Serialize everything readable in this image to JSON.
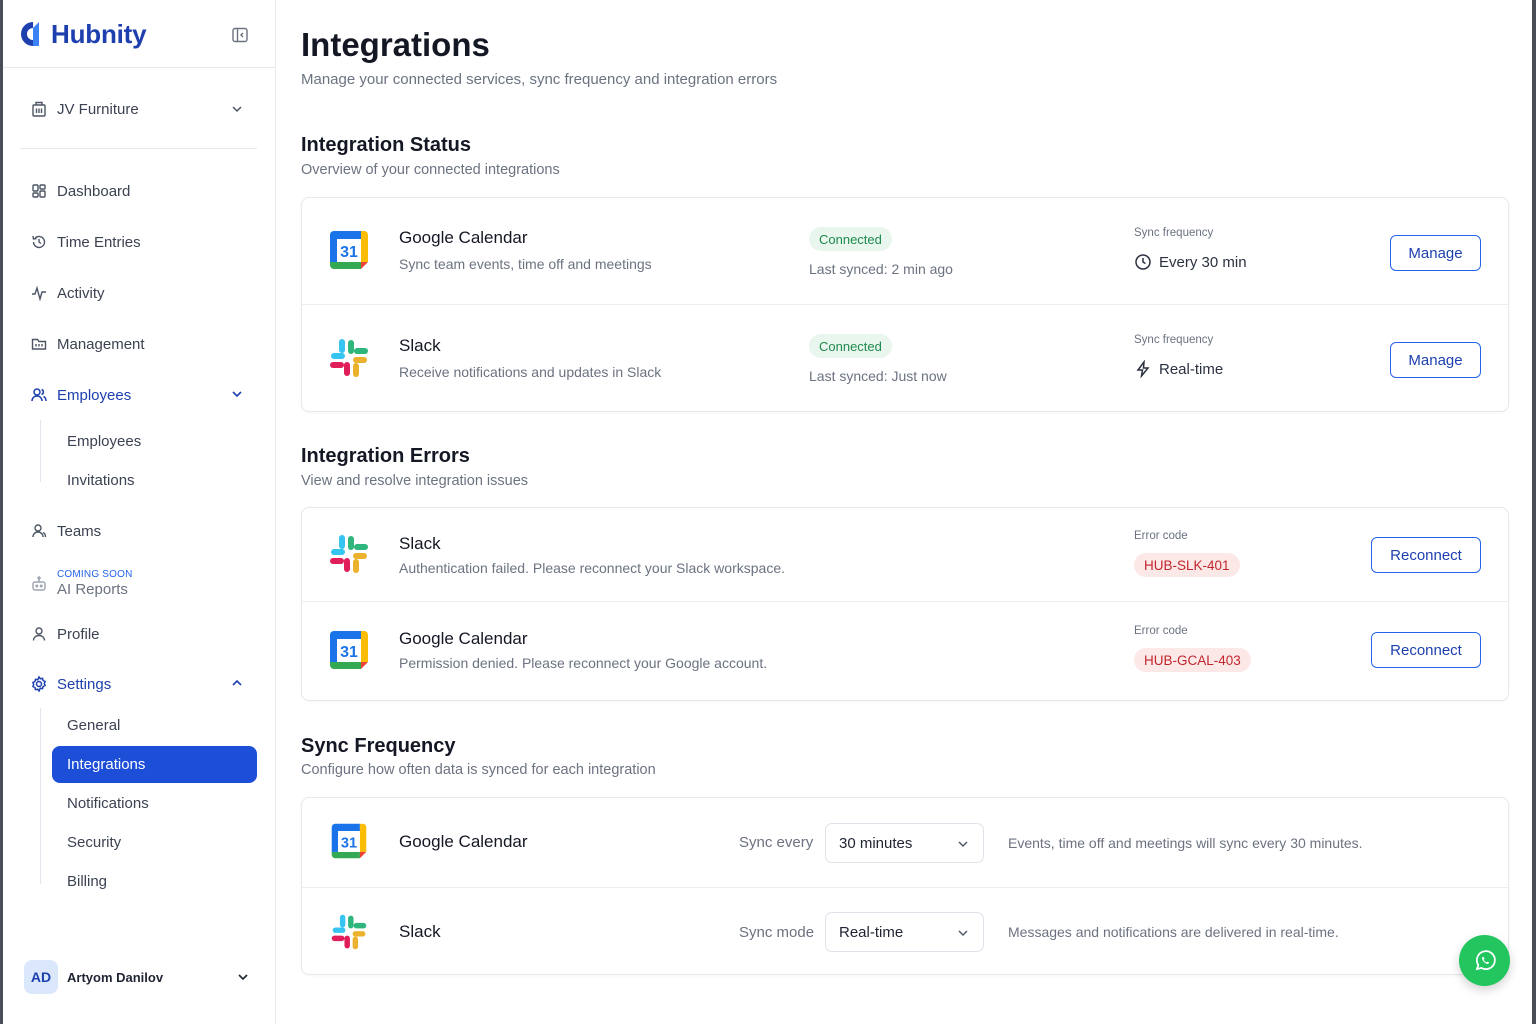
{
  "app": {
    "name": "Hubnity"
  },
  "sidebar": {
    "org": "JV Furniture",
    "items": [
      {
        "label": "Dashboard",
        "icon": "dashboard-icon"
      },
      {
        "label": "Time Entries",
        "icon": "history-icon"
      },
      {
        "label": "Activity",
        "icon": "activity-icon"
      },
      {
        "label": "Management",
        "icon": "folder-icon"
      },
      {
        "label": "Employees",
        "icon": "users-icon"
      },
      {
        "label": "Teams",
        "icon": "team-icon"
      },
      {
        "label": "AI Reports",
        "tag": "COMING SOON",
        "icon": "bot-icon"
      },
      {
        "label": "Profile",
        "icon": "user-icon"
      },
      {
        "label": "Settings",
        "icon": "gear-icon"
      }
    ],
    "employees_sub": [
      "Employees",
      "Invitations"
    ],
    "settings_sub": [
      "General",
      "Integrations",
      "Notifications",
      "Security",
      "Billing"
    ],
    "selected": "Integrations",
    "user": {
      "initials": "AD",
      "name": "Artyom Danilov"
    }
  },
  "page": {
    "title": "Integrations",
    "subtitle": "Manage your connected services, sync frequency and integration errors"
  },
  "status": {
    "title": "Integration Status",
    "subtitle": "Overview of your connected integrations",
    "rows": [
      {
        "name": "Google Calendar",
        "desc": "Sync team events, time off and meetings",
        "badge": "Connected",
        "last_synced": "Last synced:  2 min ago",
        "freq_label": "Sync frequency",
        "freq": "Every 30 min",
        "button": "Manage"
      },
      {
        "name": "Slack",
        "desc": "Receive notifications and updates in Slack",
        "badge": "Connected",
        "last_synced": "Last synced:  Just now",
        "freq_label": "Sync frequency",
        "freq": "Real-time",
        "button": "Manage"
      }
    ]
  },
  "errors": {
    "title": "Integration Errors",
    "subtitle": "View and resolve integration issues",
    "rows": [
      {
        "name": "Slack",
        "desc": "Authentication failed. Please reconnect your Slack workspace.",
        "code_label": "Error code",
        "code": "HUB-SLK-401",
        "button": "Reconnect"
      },
      {
        "name": "Google Calendar",
        "desc": "Permission denied. Please reconnect your Google account.",
        "code_label": "Error code",
        "code": "HUB-GCAL-403",
        "button": "Reconnect"
      }
    ]
  },
  "sync": {
    "title": "Sync Frequency",
    "subtitle": "Configure how often data is synced for each integration",
    "rows": [
      {
        "name": "Google Calendar",
        "label": "Sync every",
        "value": "30 minutes",
        "note": "Events, time off and meetings will sync every 30 minutes."
      },
      {
        "name": "Slack",
        "label": "Sync mode",
        "value": "Real-time",
        "note": "Messages and notifications are delivered in real-time."
      }
    ]
  },
  "colors": {
    "accent": "#1d4ed8",
    "success": "#1f8a4c",
    "error": "#c0262d",
    "whatsapp": "#22c55e"
  }
}
